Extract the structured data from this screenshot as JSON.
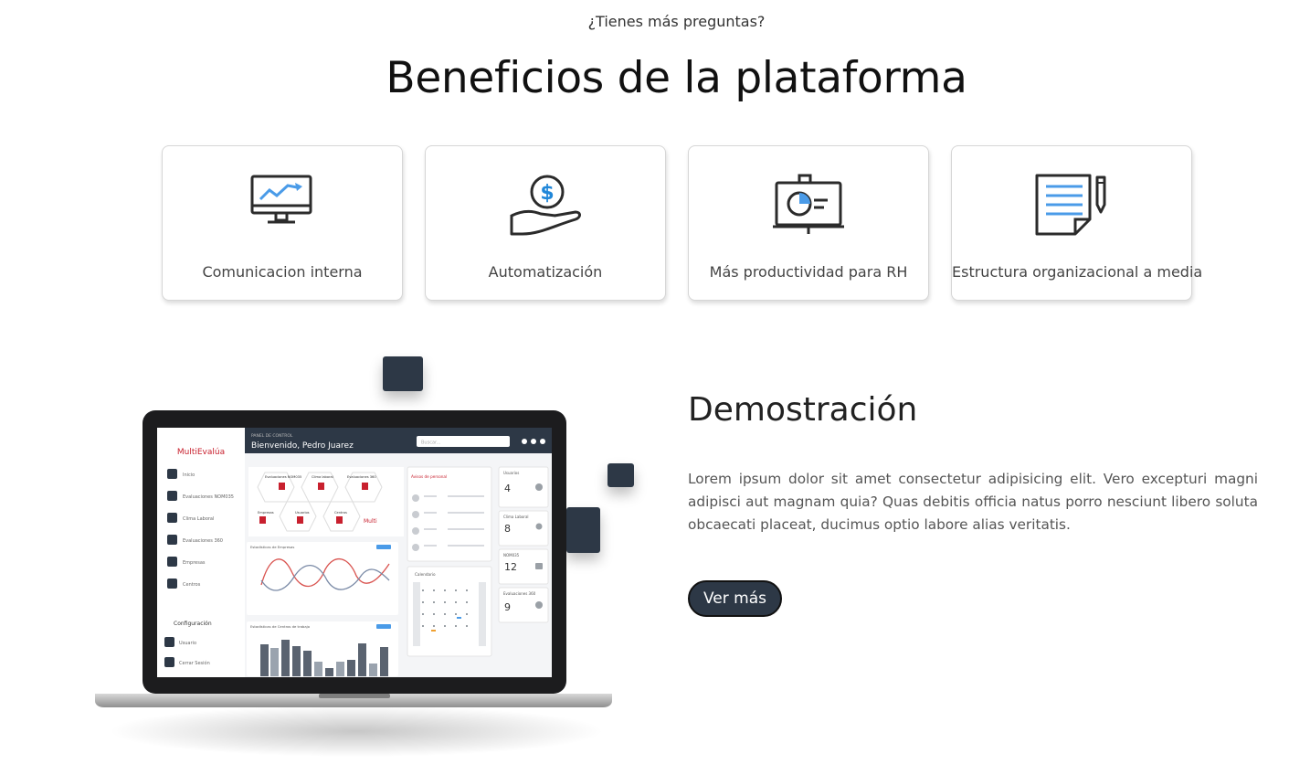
{
  "header": {
    "pre_title": "¿Tienes más preguntas?",
    "title": "Beneficios de la plataforma"
  },
  "benefits": [
    {
      "label": "Comunicacion interna",
      "icon": "monitor-chart-icon"
    },
    {
      "label": "Automatización",
      "icon": "hand-money-icon"
    },
    {
      "label": "Más productividad para RH",
      "icon": "presentation-board-icon"
    },
    {
      "label": "Estructura organizacional a media",
      "icon": "document-pen-icon"
    }
  ],
  "demo": {
    "title": "Demostración",
    "text": "Lorem ipsum dolor sit amet consectetur adipisicing elit. Vero excepturi magni adipisci aut magnam quia? Quas debitis officia natus porro nesciunt libero soluta obcaecati placeat, ducimus optio labore alias veritatis.",
    "button_label": "Ver más"
  },
  "colors": {
    "accent_blue": "#4a9be8",
    "dark_navy": "#2d3846",
    "icon_stroke": "#2b2b2b"
  },
  "dashboard_mock": {
    "logo_text": "MultiEvalúa",
    "panel_label": "PANEL DE CONTROL",
    "welcome": "Bienvenido, Pedro Juarez",
    "search_placeholder": "Buscar...",
    "sidebar_items": [
      "Inicio",
      "Evaluaciones NOM035",
      "Clima Laboral",
      "Evaluaciones 360",
      "Empresas",
      "Centros"
    ],
    "config_label": "Configuración",
    "config_items": [
      "Usuario",
      "Cerrar Sesión"
    ],
    "hex_labels": [
      "Evaluaciones NOM035",
      "Clima laboral",
      "Evaluaciones 360",
      "Empresas",
      "Usuarios",
      "Centros"
    ],
    "chart1_title": "Estadísticas de Empresas",
    "chart2_title": "Estadísticas de Centros de trabajo",
    "notices_title": "Avisos de personal",
    "calendar_title": "Calendario",
    "stats": [
      {
        "label": "Usuarios",
        "value": "4"
      },
      {
        "label": "Clima Laboral",
        "value": "8"
      },
      {
        "label": "NOM035",
        "value": "12"
      },
      {
        "label": "Evaluaciones 360",
        "value": "9"
      }
    ]
  }
}
